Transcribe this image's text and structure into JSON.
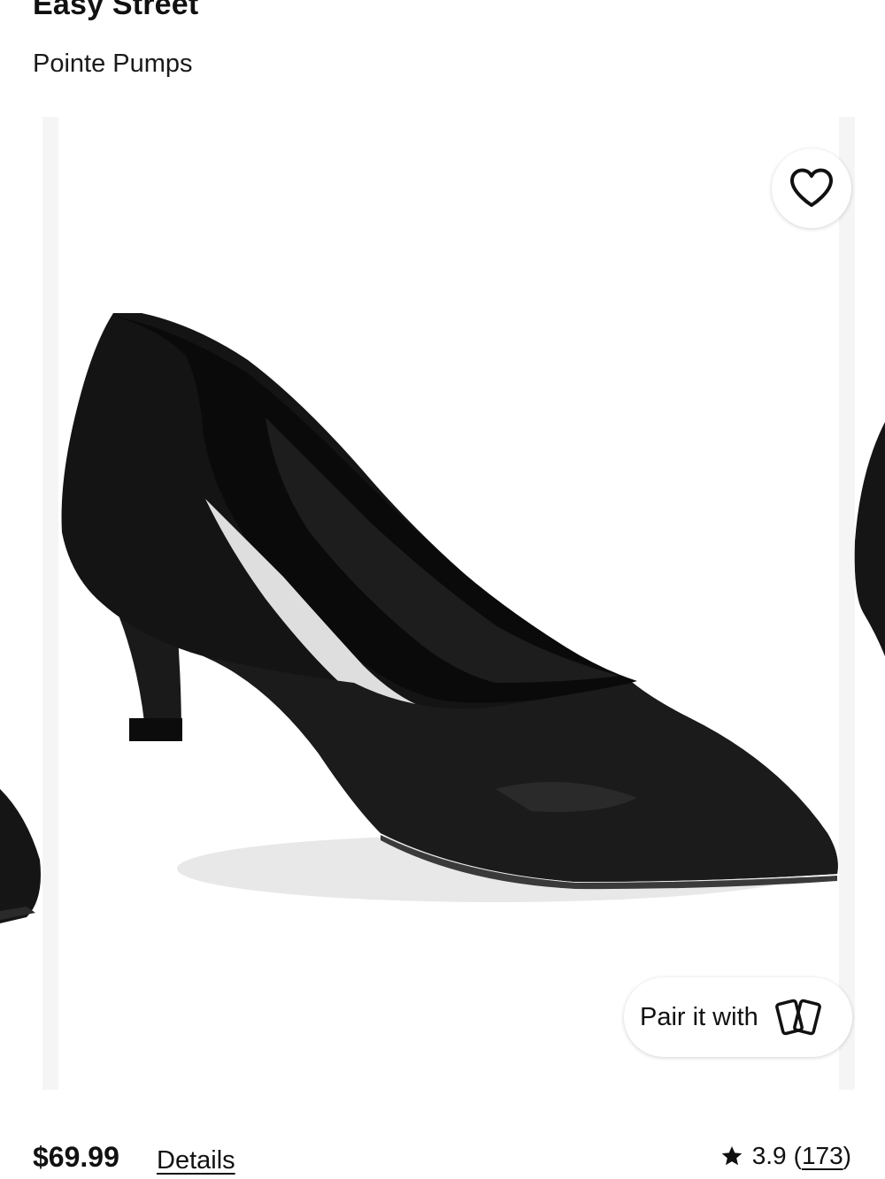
{
  "product": {
    "brand": "Easy Street",
    "name": "Pointe Pumps"
  },
  "gallery": {
    "image_alt": "Black leather pointed-toe pump with kitten heel",
    "pair_label": "Pair it with"
  },
  "pricing": {
    "price": "$69.99",
    "details_label": "Details"
  },
  "rating": {
    "value": "3.9",
    "open_paren": "(",
    "count": "173",
    "close_paren": ")"
  },
  "icons": {
    "favorite": "heart-icon",
    "pair": "cards-icon",
    "rating": "star-icon"
  }
}
